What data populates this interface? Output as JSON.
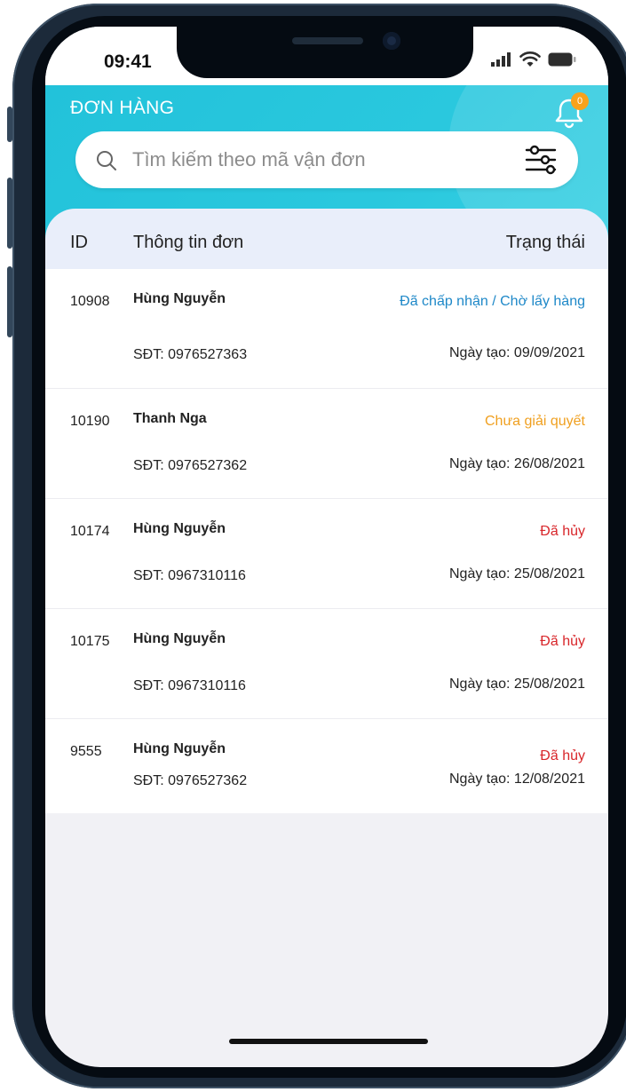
{
  "status_bar": {
    "time": "09:41"
  },
  "header": {
    "title": "ĐƠN HÀNG",
    "notification_count": "0"
  },
  "search": {
    "placeholder": "Tìm kiếm theo mã vận đơn"
  },
  "table": {
    "columns": {
      "id": "ID",
      "info": "Thông tin đơn",
      "status": "Trạng thái"
    },
    "rows": [
      {
        "id": "10908",
        "name": "Hùng Nguyễn",
        "phone": "SĐT: 0976527363",
        "status": "Đã chấp nhận / Chờ lấy hàng",
        "status_color": "#1e88c8",
        "date": "Ngày tạo: 09/09/2021"
      },
      {
        "id": "10190",
        "name": "Thanh Nga",
        "phone": "SĐT: 0976527362",
        "status": "Chưa giải quyết",
        "status_color": "#f0a020",
        "date": "Ngày tạo: 26/08/2021"
      },
      {
        "id": "10174",
        "name": "Hùng Nguyễn",
        "phone": "SĐT: 0967310116",
        "status": "Đã hủy",
        "status_color": "#d8262a",
        "date": "Ngày tạo: 25/08/2021"
      },
      {
        "id": "10175",
        "name": "Hùng Nguyễn",
        "phone": "SĐT: 0967310116",
        "status": "Đã hủy",
        "status_color": "#d8262a",
        "date": "Ngày tạo: 25/08/2021"
      },
      {
        "id": "9555",
        "name": "Hùng Nguyễn",
        "phone": "SĐT: 0976527362",
        "status": "Đã hủy",
        "status_color": "#d8262a",
        "date": "Ngày tạo: 12/08/2021"
      }
    ]
  },
  "colors": {
    "header": "#22c2da",
    "accent_badge": "#f7a21b"
  }
}
